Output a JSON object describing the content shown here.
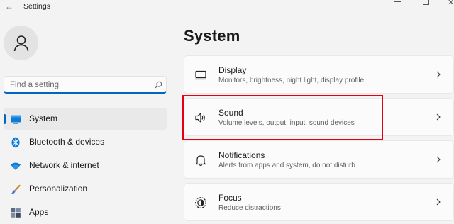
{
  "window": {
    "title": "Settings",
    "back_icon": "back-arrow-icon",
    "controls": [
      "minimize-icon",
      "maximize-icon",
      "close-icon"
    ]
  },
  "sidebar": {
    "avatar_icon": "user-icon",
    "search": {
      "placeholder": "Find a setting",
      "value": "",
      "icon": "search-icon"
    },
    "items": [
      {
        "label": "System",
        "icon": "monitor-icon",
        "selected": true
      },
      {
        "label": "Bluetooth & devices",
        "icon": "bluetooth-icon",
        "selected": false
      },
      {
        "label": "Network & internet",
        "icon": "wifi-icon",
        "selected": false
      },
      {
        "label": "Personalization",
        "icon": "brush-icon",
        "selected": false
      },
      {
        "label": "Apps",
        "icon": "apps-icon",
        "selected": false
      }
    ]
  },
  "main": {
    "title": "System",
    "cards": [
      {
        "title": "Display",
        "description": "Monitors, brightness, night light, display profile",
        "icon": "display-icon"
      },
      {
        "title": "Sound",
        "description": "Volume levels, output, input, sound devices",
        "icon": "speaker-icon",
        "highlighted": true
      },
      {
        "title": "Notifications",
        "description": "Alerts from apps and system, do not disturb",
        "icon": "bell-icon"
      },
      {
        "title": "Focus",
        "description": "Reduce distractions",
        "icon": "focus-icon"
      }
    ]
  },
  "colors": {
    "accent": "#0067c0",
    "highlight_box": "#e60012",
    "background": "#f3f3f3",
    "card": "#fbfbfb"
  }
}
